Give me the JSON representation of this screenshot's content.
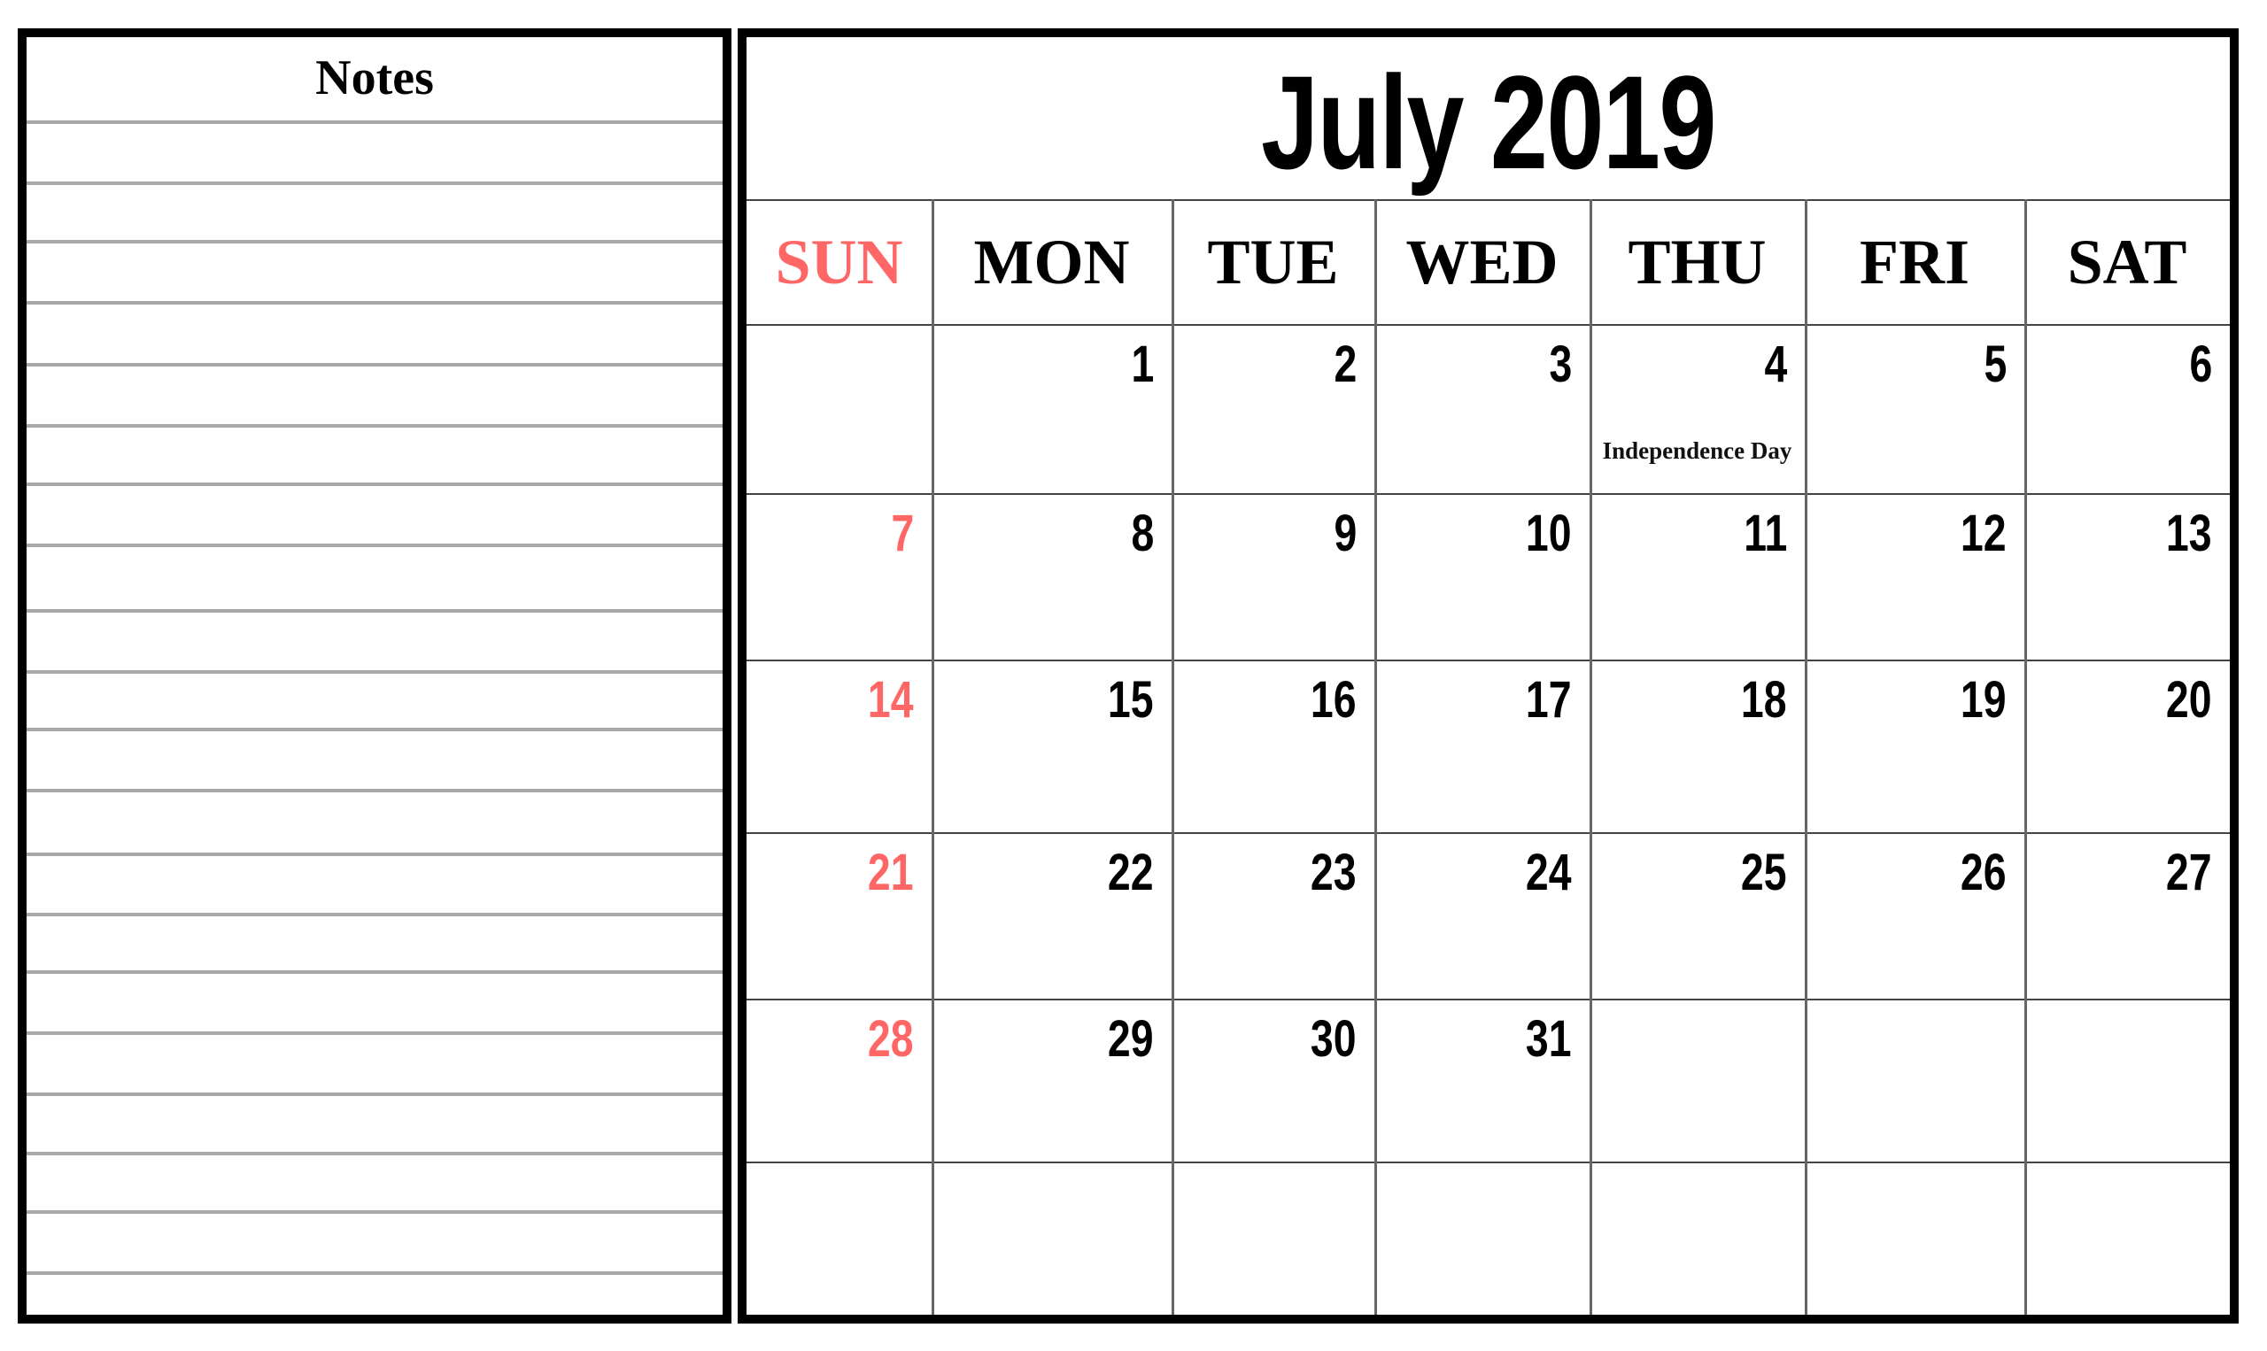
{
  "notes": {
    "title": "Notes",
    "line_count": 20
  },
  "calendar": {
    "title": "July 2019",
    "weekdays": [
      "SUN",
      "MON",
      "TUE",
      "WED",
      "THU",
      "FRI",
      "SAT"
    ],
    "weeks": [
      [
        "",
        "1",
        "2",
        "3",
        "4",
        "5",
        "6"
      ],
      [
        "7",
        "8",
        "9",
        "10",
        "11",
        "12",
        "13"
      ],
      [
        "14",
        "15",
        "16",
        "17",
        "18",
        "19",
        "20"
      ],
      [
        "21",
        "22",
        "23",
        "24",
        "25",
        "26",
        "27"
      ],
      [
        "28",
        "29",
        "30",
        "31",
        "",
        "",
        ""
      ],
      [
        "",
        "",
        "",
        "",
        "",
        "",
        ""
      ]
    ],
    "events": [
      {
        "day": "4",
        "label": "Independence Day"
      }
    ],
    "colors": {
      "sunday": "#ff6666",
      "text": "#000000",
      "frame": "#000000",
      "note_line": "#a8a8a8"
    }
  }
}
